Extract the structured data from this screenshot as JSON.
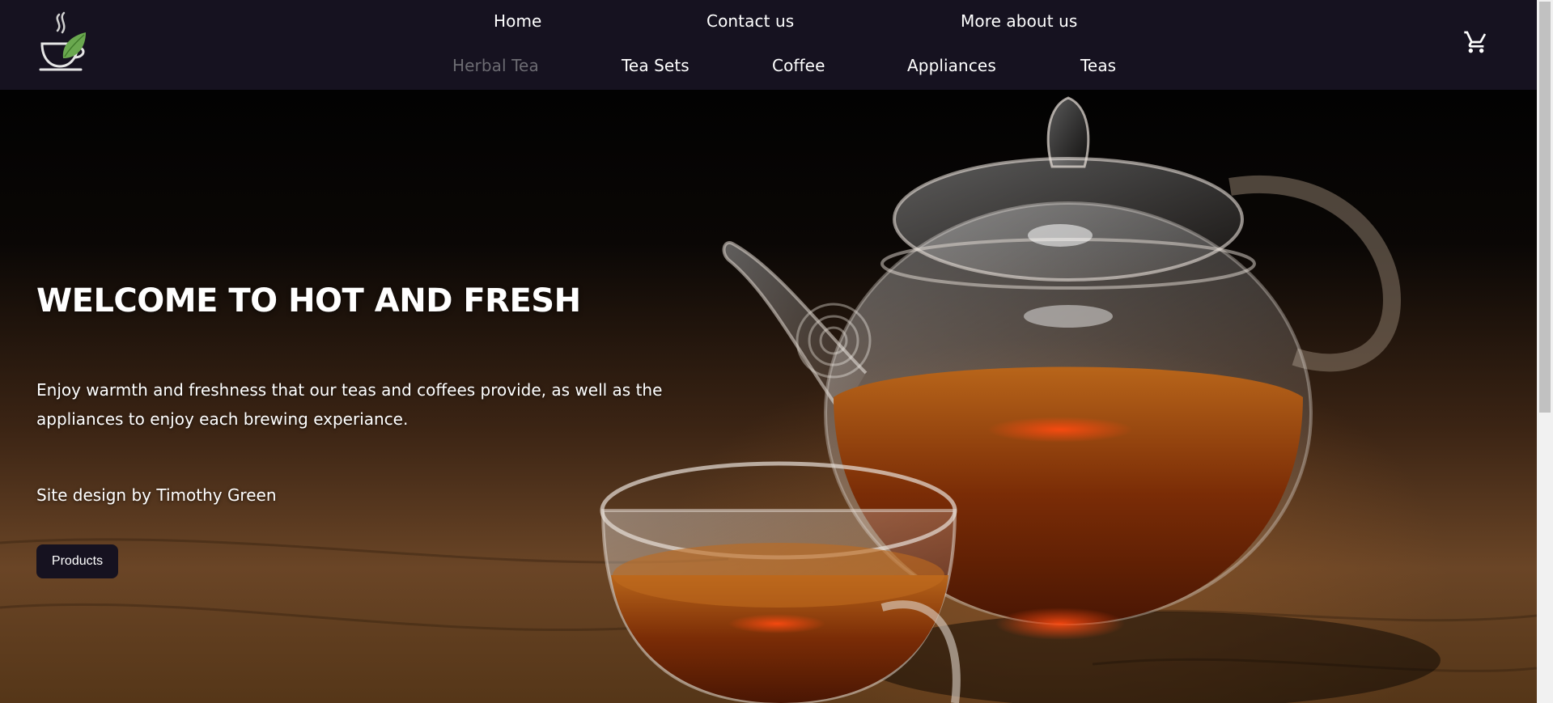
{
  "header": {
    "logo_icon": "steaming-tea-cup-with-leaf-logo",
    "nav_top": [
      {
        "label": "Home"
      },
      {
        "label": "Contact us"
      },
      {
        "label": "More about us"
      }
    ],
    "nav_bottom": [
      {
        "label": "Herbal Tea",
        "state": "muted"
      },
      {
        "label": "Tea Sets"
      },
      {
        "label": "Coffee"
      },
      {
        "label": "Appliances"
      },
      {
        "label": "Teas"
      }
    ],
    "cart_icon": "shopping-cart-icon"
  },
  "hero": {
    "title": "WELCOME TO HOT AND FRESH",
    "description": "Enjoy warmth and freshness that our teas and coffees provide, as well as the appliances to enjoy each brewing experiance.",
    "credit": "Site design by Timothy Green",
    "button_label": "Products"
  },
  "colors": {
    "header_bg": "#161220",
    "muted_link": "#6c6b72",
    "leaf_green": "#6aa84f"
  }
}
